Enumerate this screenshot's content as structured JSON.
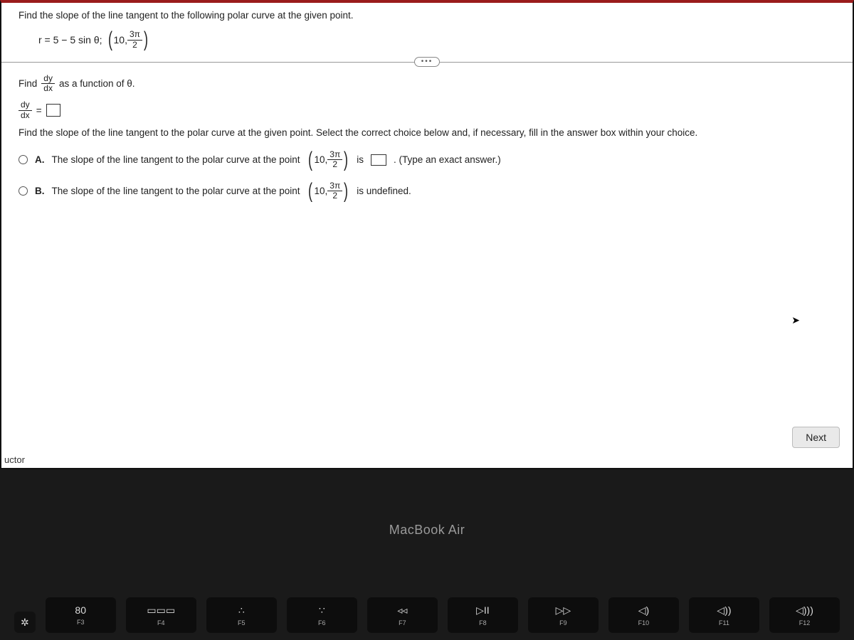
{
  "prompt": "Find the slope of the line tangent to the following polar curve at the given point.",
  "equation": {
    "lhs": "r = 5 − 5 sin θ;",
    "point_prefix": "10,",
    "frac_num": "3π",
    "frac_den": "2"
  },
  "ellipsis": "•••",
  "find_text_prefix": "Find",
  "find_text_suffix": "as a function of θ.",
  "dydx_num": "dy",
  "dydx_den": "dx",
  "equals": "=",
  "instruction": "Find the slope of the line tangent to the polar curve at the given point. Select the correct choice below and, if necessary, fill in the answer box within your choice.",
  "choiceA": {
    "label": "A.",
    "pre": "The slope of the line tangent to the polar curve at the point",
    "point_prefix": "10,",
    "frac_num": "3π",
    "frac_den": "2",
    "mid": "is",
    "post": ". (Type an exact answer.)"
  },
  "choiceB": {
    "label": "B.",
    "pre": "The slope of the line tangent to the polar curve at the point",
    "point_prefix": "10,",
    "frac_num": "3π",
    "frac_den": "2",
    "post": "is undefined."
  },
  "next": "Next",
  "cutoff": "uctor",
  "mba": "MacBook Air",
  "keys": [
    {
      "icon": "✲",
      "label": ""
    },
    {
      "icon": "80",
      "label": "F3"
    },
    {
      "icon": "▭▭▭",
      "label": "F4"
    },
    {
      "icon": "∴",
      "label": "F5"
    },
    {
      "icon": "∵",
      "label": "F6"
    },
    {
      "icon": "◃◃",
      "label": "F7"
    },
    {
      "icon": "▷II",
      "label": "F8"
    },
    {
      "icon": "▷▷",
      "label": "F9"
    },
    {
      "icon": "◁)",
      "label": "F10"
    },
    {
      "icon": "◁))",
      "label": "F11"
    },
    {
      "icon": "◁)))",
      "label": "F12"
    }
  ]
}
